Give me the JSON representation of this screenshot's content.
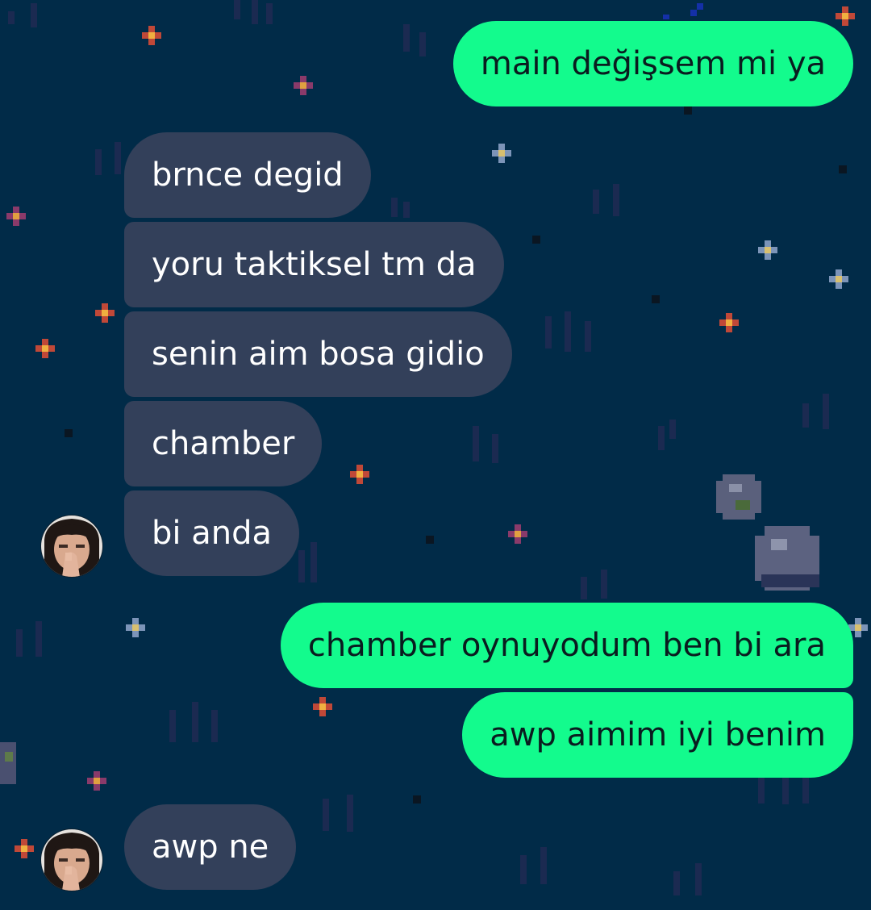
{
  "colors": {
    "background": "#012b48",
    "incoming_bubble": "#33405a",
    "outgoing_bubble": "#13fb8d",
    "incoming_text": "#ffffff",
    "outgoing_text": "#0a1c1f"
  },
  "messages": [
    {
      "direction": "outgoing",
      "text": "main değişsem mi ya"
    },
    {
      "direction": "incoming",
      "text": "brnce degid"
    },
    {
      "direction": "incoming",
      "text": "yoru taktiksel tm da"
    },
    {
      "direction": "incoming",
      "text": "senin aim bosa gidio"
    },
    {
      "direction": "incoming",
      "text": "chamber"
    },
    {
      "direction": "incoming",
      "text": "bi anda",
      "avatar": "contact-avatar"
    },
    {
      "direction": "outgoing",
      "text": "chamber oynuyodum ben bi ara"
    },
    {
      "direction": "outgoing",
      "text": "awp aimim iyi benim"
    },
    {
      "direction": "incoming",
      "text": "awp ne",
      "avatar": "contact-avatar"
    }
  ]
}
